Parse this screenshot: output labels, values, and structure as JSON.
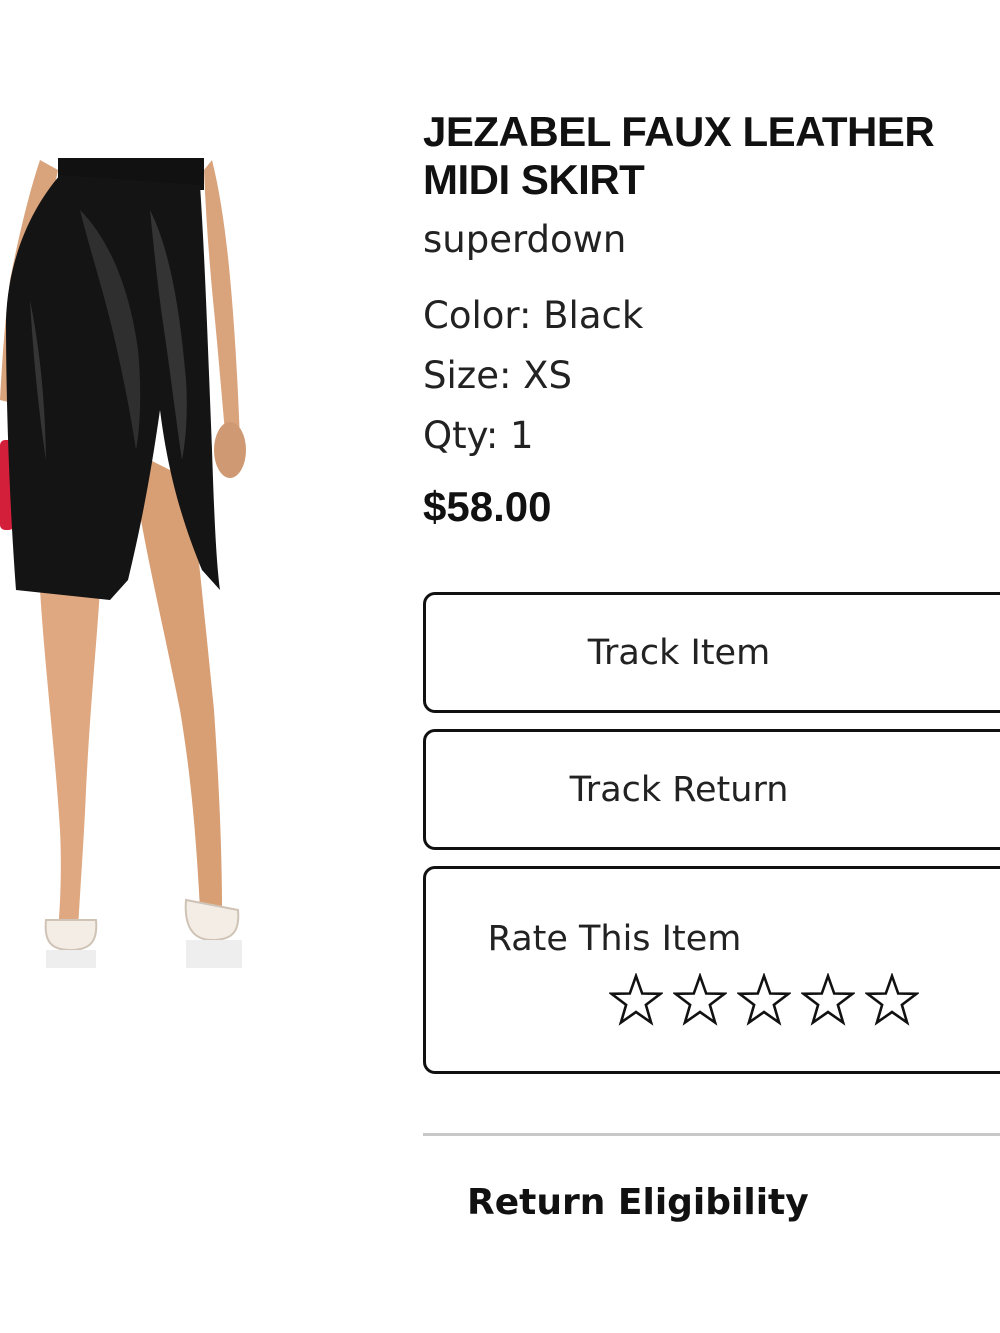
{
  "product": {
    "title": "JEZABEL FAUX LEATHER\nMIDI SKIRT",
    "brand": "superdown",
    "color_text": "Color: Black",
    "size_text": "Size: XS",
    "qty_text": "Qty: 1",
    "price": "$58.00",
    "image_icon": "product-photo"
  },
  "actions": {
    "track_item": "Track Item",
    "track_return": "Track Return",
    "rate_label": "Rate This Item",
    "rating": {
      "max": 5,
      "value": 0,
      "star_icon": "star-outline-icon"
    }
  },
  "footer": {
    "return_eligibility": "Return Eligibility"
  },
  "colors": {
    "text": "#111111",
    "border": "#111111",
    "divider": "#c8c8c8",
    "background": "#ffffff"
  }
}
